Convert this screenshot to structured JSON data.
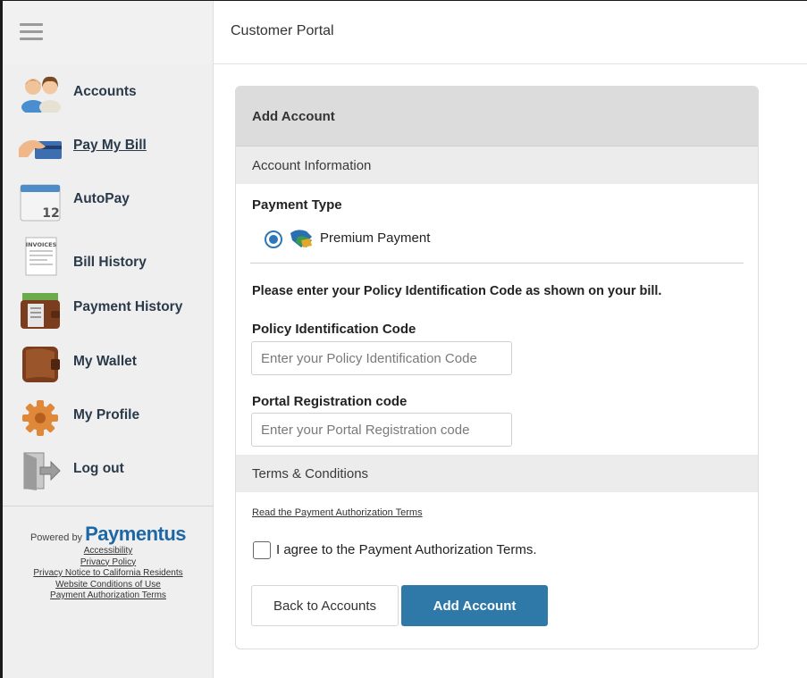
{
  "header": {
    "title": "Customer Portal"
  },
  "sidebar": {
    "items": [
      {
        "label": "Accounts",
        "icon": "accounts-icon"
      },
      {
        "label": "Pay My Bill",
        "icon": "pay-bill-icon"
      },
      {
        "label": "AutoPay",
        "icon": "calendar-icon"
      },
      {
        "label": "Bill History",
        "icon": "invoice-icon"
      },
      {
        "label": "Payment History",
        "icon": "wallet-cash-icon"
      },
      {
        "label": "My Wallet",
        "icon": "wallet-icon"
      },
      {
        "label": "My Profile",
        "icon": "gear-icon"
      },
      {
        "label": "Log out",
        "icon": "logout-door-icon"
      }
    ],
    "icon_text": {
      "invoice": "INVOICES",
      "calendar_day": "12"
    },
    "footer": {
      "powered_by": "Powered by",
      "brand": "Paymentus",
      "links": [
        "Accessibility",
        "Privacy Policy",
        "Privacy Notice to California Residents",
        "Website Conditions of Use",
        "Payment Authorization Terms"
      ]
    }
  },
  "card": {
    "title": "Add Account",
    "account_info_section": "Account Information",
    "payment_type_label": "Payment Type",
    "payment_option": "Premium Payment",
    "instruction": "Please enter your Policy Identification Code as shown on your bill.",
    "policy_code_label": "Policy Identification Code",
    "policy_code_placeholder": "Enter your Policy Identification Code",
    "registration_label": "Portal Registration code",
    "registration_placeholder": "Enter your Portal Registration code",
    "terms_section": "Terms & Conditions",
    "terms_link": "Read the Payment Authorization Terms",
    "agree_label": "I agree to the Payment Authorization Terms.",
    "back_button": "Back to Accounts",
    "add_button": "Add Account"
  },
  "colors": {
    "accent": "#2f79a9",
    "brand": "#1d67a6",
    "sidebar_bg": "#efefef",
    "header_bg": "#dcdcdc"
  }
}
